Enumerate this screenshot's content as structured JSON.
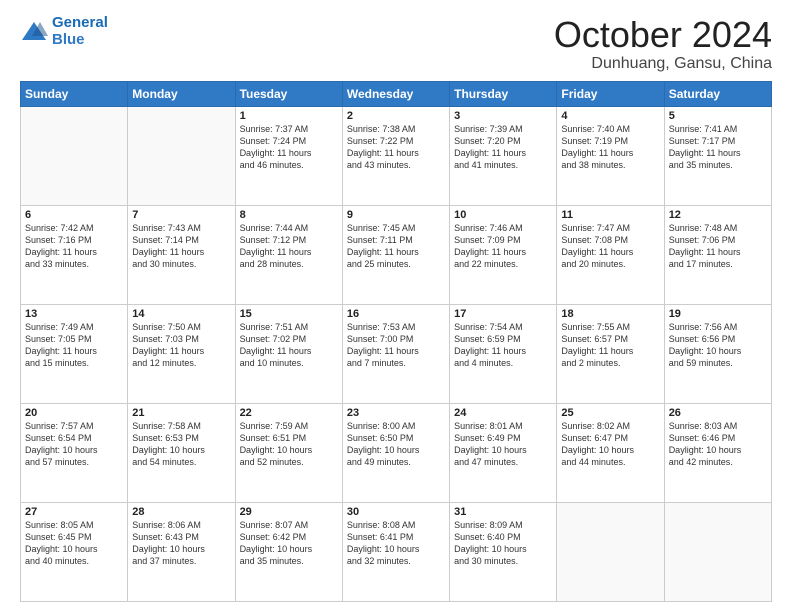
{
  "header": {
    "logo_line1": "General",
    "logo_line2": "Blue",
    "month": "October 2024",
    "location": "Dunhuang, Gansu, China"
  },
  "days_of_week": [
    "Sunday",
    "Monday",
    "Tuesday",
    "Wednesday",
    "Thursday",
    "Friday",
    "Saturday"
  ],
  "weeks": [
    [
      {
        "day": "",
        "text": ""
      },
      {
        "day": "",
        "text": ""
      },
      {
        "day": "1",
        "text": "Sunrise: 7:37 AM\nSunset: 7:24 PM\nDaylight: 11 hours\nand 46 minutes."
      },
      {
        "day": "2",
        "text": "Sunrise: 7:38 AM\nSunset: 7:22 PM\nDaylight: 11 hours\nand 43 minutes."
      },
      {
        "day": "3",
        "text": "Sunrise: 7:39 AM\nSunset: 7:20 PM\nDaylight: 11 hours\nand 41 minutes."
      },
      {
        "day": "4",
        "text": "Sunrise: 7:40 AM\nSunset: 7:19 PM\nDaylight: 11 hours\nand 38 minutes."
      },
      {
        "day": "5",
        "text": "Sunrise: 7:41 AM\nSunset: 7:17 PM\nDaylight: 11 hours\nand 35 minutes."
      }
    ],
    [
      {
        "day": "6",
        "text": "Sunrise: 7:42 AM\nSunset: 7:16 PM\nDaylight: 11 hours\nand 33 minutes."
      },
      {
        "day": "7",
        "text": "Sunrise: 7:43 AM\nSunset: 7:14 PM\nDaylight: 11 hours\nand 30 minutes."
      },
      {
        "day": "8",
        "text": "Sunrise: 7:44 AM\nSunset: 7:12 PM\nDaylight: 11 hours\nand 28 minutes."
      },
      {
        "day": "9",
        "text": "Sunrise: 7:45 AM\nSunset: 7:11 PM\nDaylight: 11 hours\nand 25 minutes."
      },
      {
        "day": "10",
        "text": "Sunrise: 7:46 AM\nSunset: 7:09 PM\nDaylight: 11 hours\nand 22 minutes."
      },
      {
        "day": "11",
        "text": "Sunrise: 7:47 AM\nSunset: 7:08 PM\nDaylight: 11 hours\nand 20 minutes."
      },
      {
        "day": "12",
        "text": "Sunrise: 7:48 AM\nSunset: 7:06 PM\nDaylight: 11 hours\nand 17 minutes."
      }
    ],
    [
      {
        "day": "13",
        "text": "Sunrise: 7:49 AM\nSunset: 7:05 PM\nDaylight: 11 hours\nand 15 minutes."
      },
      {
        "day": "14",
        "text": "Sunrise: 7:50 AM\nSunset: 7:03 PM\nDaylight: 11 hours\nand 12 minutes."
      },
      {
        "day": "15",
        "text": "Sunrise: 7:51 AM\nSunset: 7:02 PM\nDaylight: 11 hours\nand 10 minutes."
      },
      {
        "day": "16",
        "text": "Sunrise: 7:53 AM\nSunset: 7:00 PM\nDaylight: 11 hours\nand 7 minutes."
      },
      {
        "day": "17",
        "text": "Sunrise: 7:54 AM\nSunset: 6:59 PM\nDaylight: 11 hours\nand 4 minutes."
      },
      {
        "day": "18",
        "text": "Sunrise: 7:55 AM\nSunset: 6:57 PM\nDaylight: 11 hours\nand 2 minutes."
      },
      {
        "day": "19",
        "text": "Sunrise: 7:56 AM\nSunset: 6:56 PM\nDaylight: 10 hours\nand 59 minutes."
      }
    ],
    [
      {
        "day": "20",
        "text": "Sunrise: 7:57 AM\nSunset: 6:54 PM\nDaylight: 10 hours\nand 57 minutes."
      },
      {
        "day": "21",
        "text": "Sunrise: 7:58 AM\nSunset: 6:53 PM\nDaylight: 10 hours\nand 54 minutes."
      },
      {
        "day": "22",
        "text": "Sunrise: 7:59 AM\nSunset: 6:51 PM\nDaylight: 10 hours\nand 52 minutes."
      },
      {
        "day": "23",
        "text": "Sunrise: 8:00 AM\nSunset: 6:50 PM\nDaylight: 10 hours\nand 49 minutes."
      },
      {
        "day": "24",
        "text": "Sunrise: 8:01 AM\nSunset: 6:49 PM\nDaylight: 10 hours\nand 47 minutes."
      },
      {
        "day": "25",
        "text": "Sunrise: 8:02 AM\nSunset: 6:47 PM\nDaylight: 10 hours\nand 44 minutes."
      },
      {
        "day": "26",
        "text": "Sunrise: 8:03 AM\nSunset: 6:46 PM\nDaylight: 10 hours\nand 42 minutes."
      }
    ],
    [
      {
        "day": "27",
        "text": "Sunrise: 8:05 AM\nSunset: 6:45 PM\nDaylight: 10 hours\nand 40 minutes."
      },
      {
        "day": "28",
        "text": "Sunrise: 8:06 AM\nSunset: 6:43 PM\nDaylight: 10 hours\nand 37 minutes."
      },
      {
        "day": "29",
        "text": "Sunrise: 8:07 AM\nSunset: 6:42 PM\nDaylight: 10 hours\nand 35 minutes."
      },
      {
        "day": "30",
        "text": "Sunrise: 8:08 AM\nSunset: 6:41 PM\nDaylight: 10 hours\nand 32 minutes."
      },
      {
        "day": "31",
        "text": "Sunrise: 8:09 AM\nSunset: 6:40 PM\nDaylight: 10 hours\nand 30 minutes."
      },
      {
        "day": "",
        "text": ""
      },
      {
        "day": "",
        "text": ""
      }
    ]
  ]
}
